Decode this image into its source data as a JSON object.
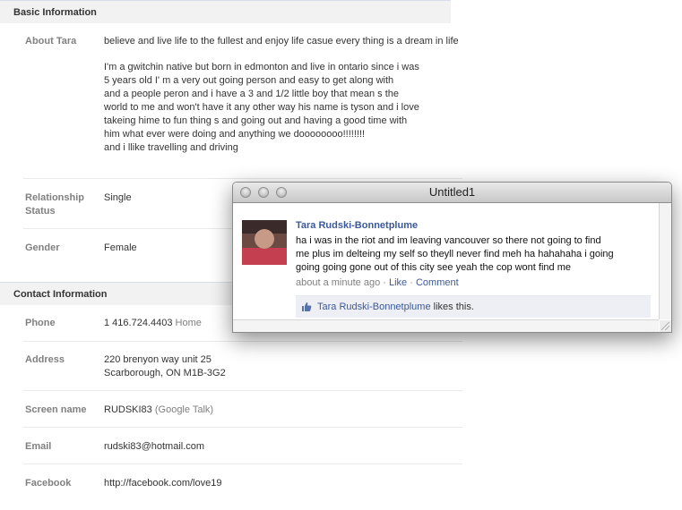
{
  "basic": {
    "heading": "Basic Information",
    "about_label": "About Tara",
    "about_p1": "believe and live life to the fullest and enjoy life casue every thing is a dream in life",
    "about_p2_lines": [
      "I'm a gwitchin native but born in edmonton and live in ontario since i was",
      "5 years old I' m a very out going person and easy to get along with",
      "and a people peron and i have a 3 and 1/2 little boy that mean s the",
      "world to me and won't have it any other way his name is tyson and i love",
      "takeing hime to fun thing s and going out and having a good time with",
      "him what ever were doing and anything we doooooooo!!!!!!!!",
      "and i llike travelling and driving"
    ],
    "relationship_label_1": "Relationship",
    "relationship_label_2": "Status",
    "relationship_value": "Single",
    "gender_label": "Gender",
    "gender_value": "Female"
  },
  "contact": {
    "heading": "Contact Information",
    "phone_label": "Phone",
    "phone_value": "1 416.724.4403",
    "phone_type": "Home",
    "address_label": "Address",
    "address_line1": "220 brenyon way unit 25",
    "address_line2": "Scarborough, ON M1B-3G2",
    "screen_label": "Screen name",
    "screen_value": "RUDSKI83",
    "screen_service": "(Google Talk)",
    "email_label": "Email",
    "email_value": "rudski83@hotmail.com",
    "facebook_label": "Facebook",
    "facebook_value": "http://facebook.com/love19"
  },
  "popup": {
    "title": "Untitled1",
    "author": "Tara Rudski-Bonnetplume",
    "text_lines": [
      "ha i was in the riot and im leaving vancouver so there not going to find",
      "me plus im delteing my self so theyll never find meh ha hahahaha i going",
      "going going gone out of this city see yeah the cop wont find me"
    ],
    "time": "about a minute ago",
    "sep": "·",
    "like": "Like",
    "comment": "Comment",
    "likes_name": "Tara Rudski-Bonnetplume",
    "likes_suffix": "likes this."
  }
}
